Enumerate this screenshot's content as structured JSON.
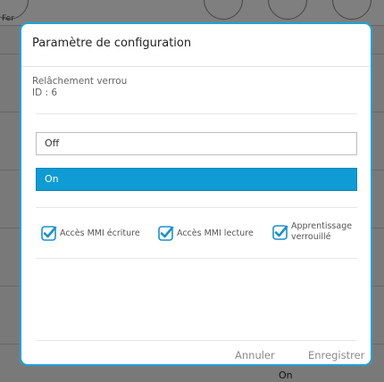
{
  "background": {
    "header_label": "Fer",
    "on_label": "On"
  },
  "dialog": {
    "title": "Paramètre de configuration",
    "item_name": "Relâchement verrou",
    "item_id": "ID : 6",
    "options": [
      {
        "label": "Off",
        "selected": false
      },
      {
        "label": "On",
        "selected": true
      }
    ],
    "checkboxes": [
      {
        "label": "Accès MMI écriture",
        "checked": true
      },
      {
        "label": "Accès MMI lecture",
        "checked": true
      },
      {
        "label_line1": "Apprentissage",
        "label_line2": "verrouillé",
        "checked": true
      }
    ],
    "cancel_label": "Annuler",
    "save_label": "Enregistrer"
  },
  "colors": {
    "accent": "#20a3d6",
    "selected_option": "#0f9bd3",
    "checkbox": "#1e90c8"
  }
}
